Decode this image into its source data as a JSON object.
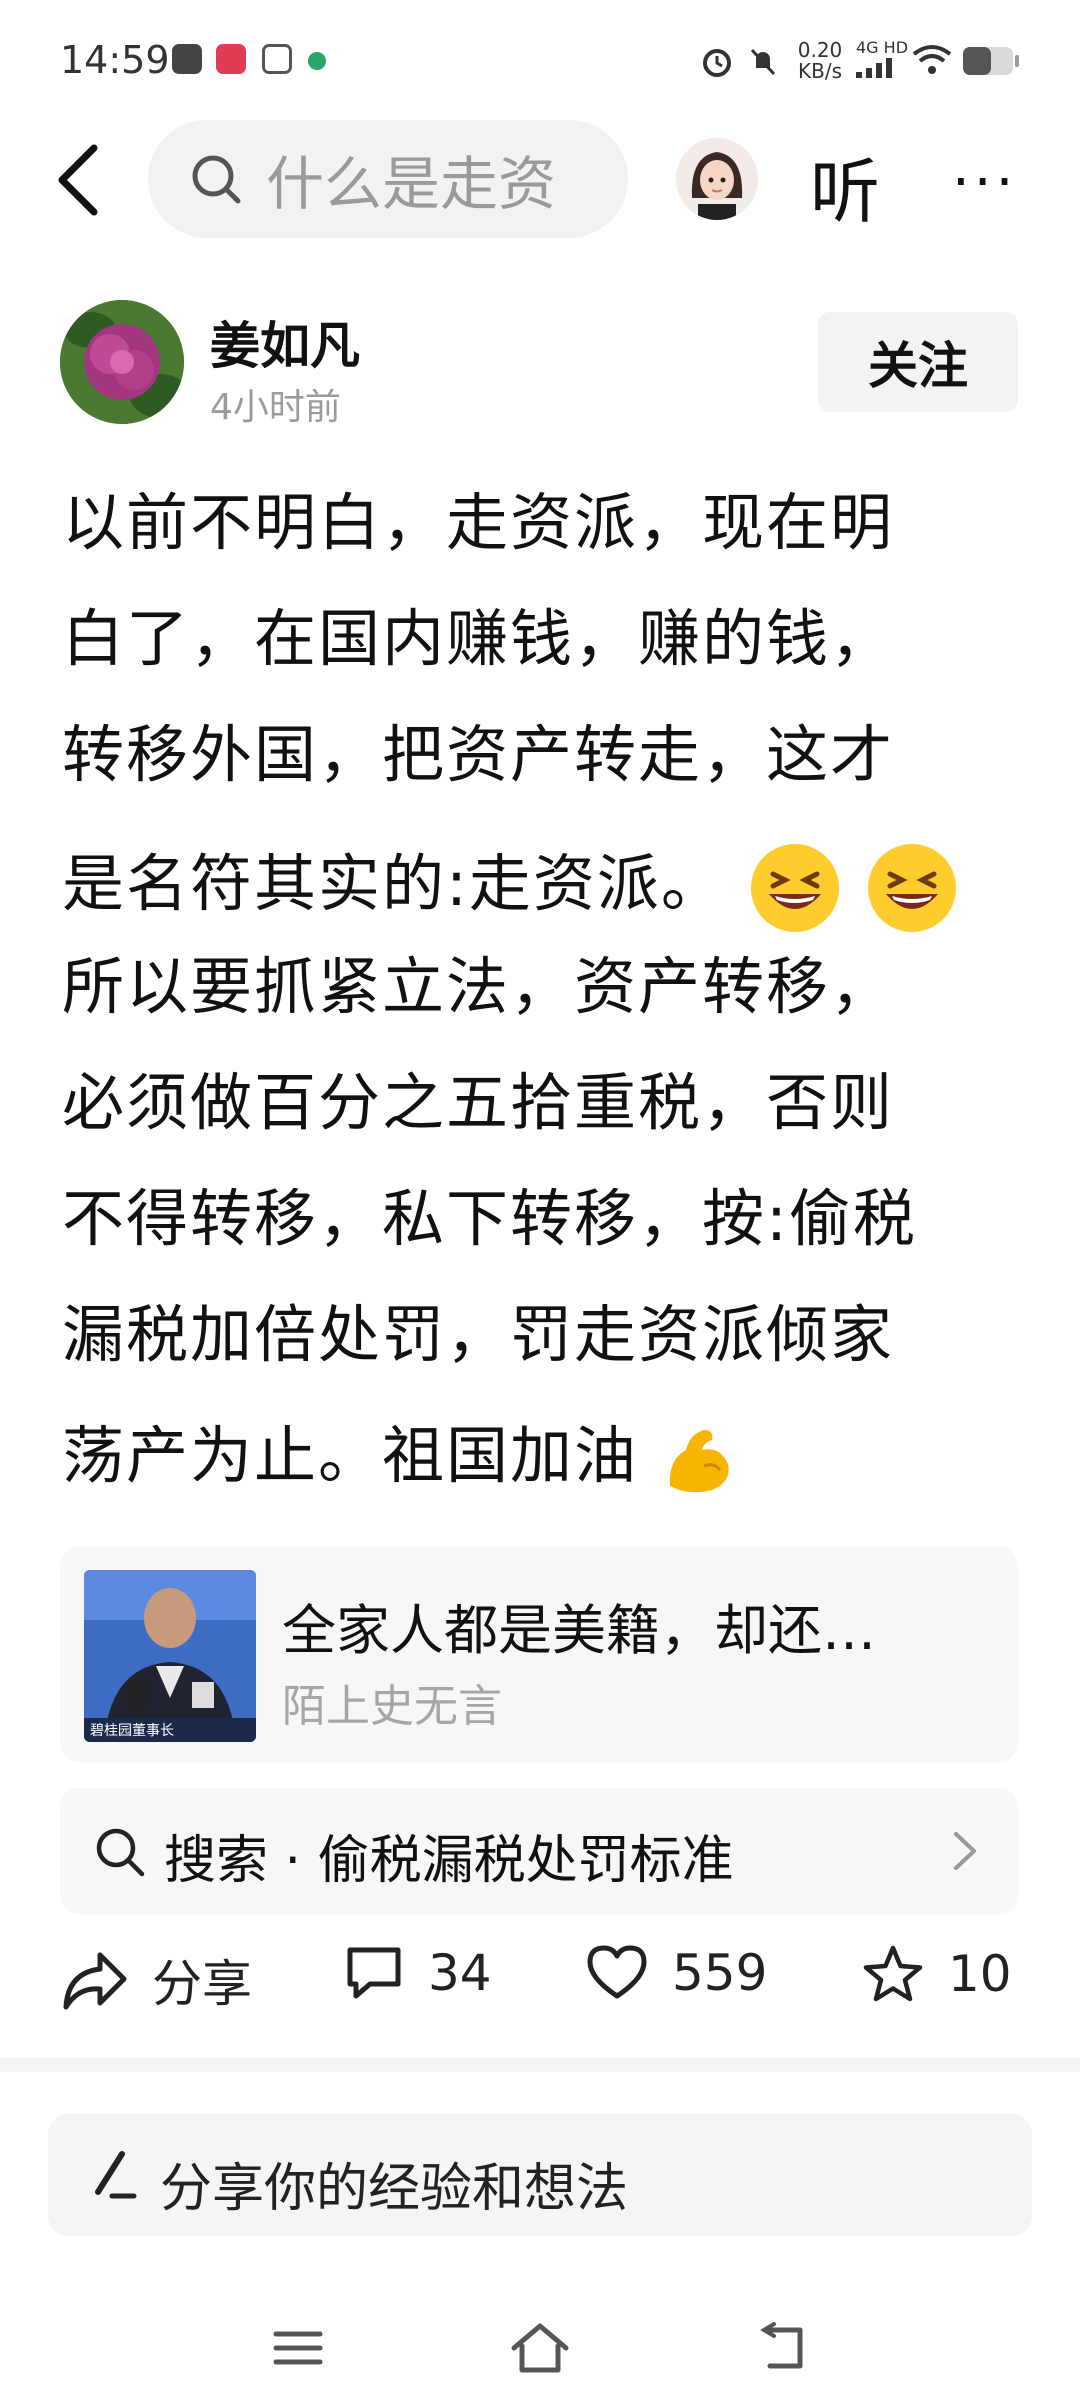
{
  "status_bar": {
    "time": "14:59",
    "net_speed_value": "0.20",
    "net_speed_unit": "KB/s",
    "network": "4G HD"
  },
  "header": {
    "search_placeholder": "什么是走资",
    "listen_label": "听",
    "more_label": "···"
  },
  "author": {
    "name": "姜如凡",
    "time": "4小时前",
    "follow_label": "关注"
  },
  "post": {
    "lines": [
      "以前不明白，走资派，现在明",
      "白了，在国内赚钱，赚的钱，",
      "转移外国，把资产转走，这才",
      "是名符其实的:走资派。",
      "所以要抓紧立法，资产转移，",
      "必须做百分之五拾重税，否则",
      "不得转移，私下转移，按:偷税",
      "漏税加倍处罚，罚走资派倾家",
      "荡产为止。祖国加油"
    ]
  },
  "linked_article": {
    "title": "全家人都是美籍，却还…",
    "source": "陌上史无言",
    "thumb_caption": "碧桂园董事长"
  },
  "related_search": {
    "prefix": "搜索",
    "separator": "·",
    "query": "偷税漏税处罚标准"
  },
  "actions": {
    "share_label": "分享",
    "comments": "34",
    "likes": "559",
    "favorites": "10"
  },
  "comment_input": {
    "placeholder": "分享你的经验和想法"
  },
  "colors": {
    "accent_bg": "#f6f7f9",
    "muted_text": "#9b9b9b"
  }
}
